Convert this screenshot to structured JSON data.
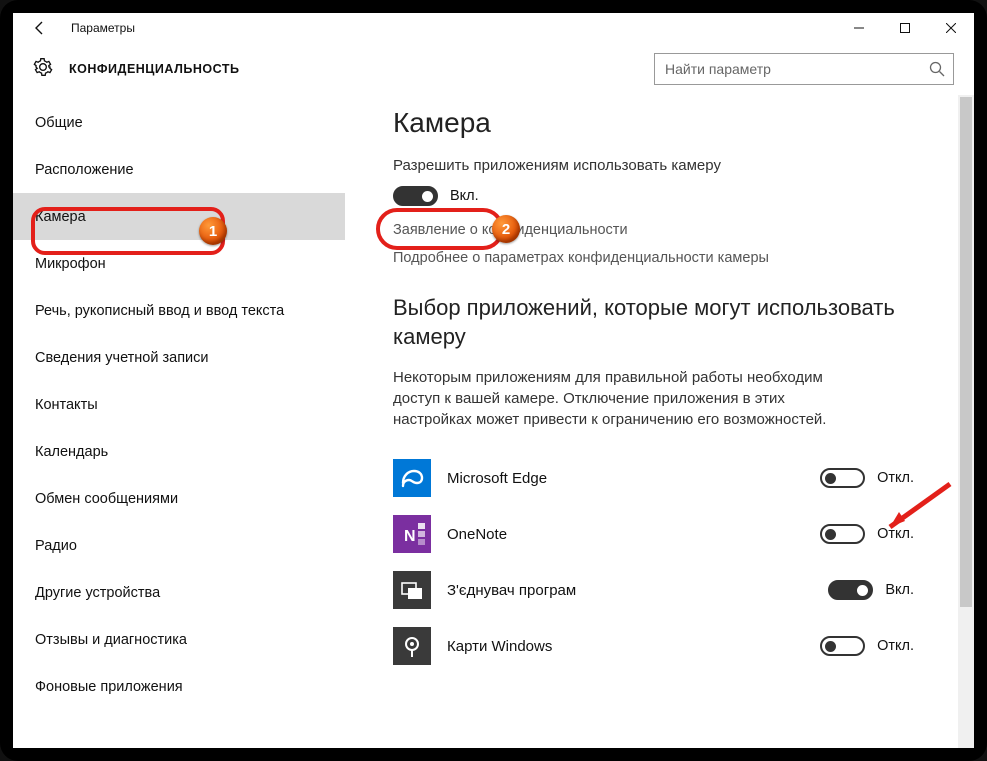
{
  "titlebar": {
    "title": "Параметры"
  },
  "header": {
    "title": "КОНФИДЕНЦИАЛЬНОСТЬ"
  },
  "search": {
    "placeholder": "Найти параметр"
  },
  "sidebar": {
    "items": [
      {
        "label": "Общие",
        "selected": false
      },
      {
        "label": "Расположение",
        "selected": false
      },
      {
        "label": "Камера",
        "selected": true
      },
      {
        "label": "Микрофон",
        "selected": false
      },
      {
        "label": "Речь, рукописный ввод и ввод текста",
        "selected": false
      },
      {
        "label": "Сведения учетной записи",
        "selected": false
      },
      {
        "label": "Контакты",
        "selected": false
      },
      {
        "label": "Календарь",
        "selected": false
      },
      {
        "label": "Обмен сообщениями",
        "selected": false
      },
      {
        "label": "Радио",
        "selected": false
      },
      {
        "label": "Другие устройства",
        "selected": false
      },
      {
        "label": "Отзывы и диагностика",
        "selected": false
      },
      {
        "label": "Фоновые приложения",
        "selected": false
      }
    ]
  },
  "main": {
    "heading": "Камера",
    "allow_label": "Разрешить приложениям использовать камеру",
    "master_toggle": {
      "on": true,
      "label": "Вкл."
    },
    "privacy_link": "Заявление о конфиденциальности",
    "learn_link": "Подробнее о параметрах конфиденциальности камеры",
    "choose_heading": "Выбор приложений, которые могут использовать камеру",
    "choose_desc": "Некоторым приложениям для правильной работы необходим доступ к вашей камере. Отключение приложения в этих настройках может привести к ограничению его возможностей.",
    "apps": [
      {
        "name": "Microsoft Edge",
        "icon": "edge",
        "color": "#0078d7",
        "on": false,
        "state_label": "Откл."
      },
      {
        "name": "OneNote",
        "icon": "onenote",
        "color": "#7b2fa0",
        "on": false,
        "state_label": "Откл."
      },
      {
        "name": "З'єднувач програм",
        "icon": "connector",
        "color": "#3a3a3a",
        "on": true,
        "state_label": "Вкл."
      },
      {
        "name": "Карти Windows",
        "icon": "maps",
        "color": "#3a3a3a",
        "on": false,
        "state_label": "Откл."
      }
    ]
  },
  "annotations": {
    "badge1": "1",
    "badge2": "2"
  }
}
